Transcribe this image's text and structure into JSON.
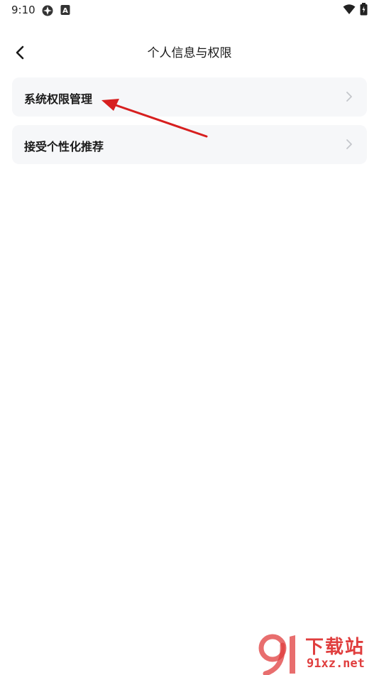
{
  "status_bar": {
    "time": "9:10",
    "icons_left": [
      "app-notification-icon",
      "keyboard-a-icon"
    ],
    "icons_right": [
      "wifi-icon",
      "battery-icon"
    ]
  },
  "header": {
    "back_icon": "chevron-left-icon",
    "title": "个人信息与权限"
  },
  "menu": {
    "items": [
      {
        "label": "系统权限管理",
        "icon": "chevron-right-icon"
      },
      {
        "label": "接受个性化推荐",
        "icon": "chevron-right-icon"
      }
    ]
  },
  "watermark": {
    "brand": "下载站",
    "site": "91xz.net"
  },
  "colors": {
    "card_background": "#f6f7f9",
    "annotation_arrow": "#d71f1f",
    "watermark": "#e03e3e"
  }
}
